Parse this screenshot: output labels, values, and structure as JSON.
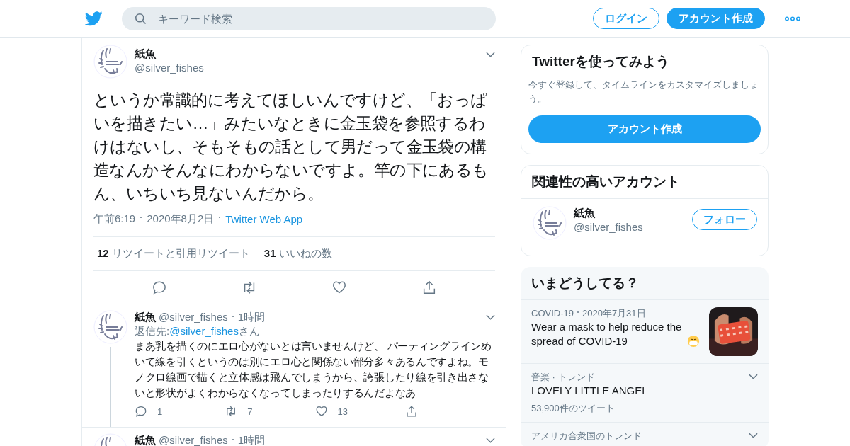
{
  "header": {
    "search": {
      "placeholder": "キーワード検索"
    },
    "buttons": [
      {
        "label": "ログイン",
        "kind": "outline"
      },
      {
        "label": "アカウント作成",
        "kind": "filled"
      }
    ]
  },
  "main_tweet": {
    "name": "紙魚",
    "handle": "@silver_fishes",
    "text": "というか常識的に考えてほしいんですけど、「おっぱいを描きたい…」みたいなときに金玉袋を参照するわけはないし、そもそもの話として男だって金玉袋の構造なんかそんなにわからないですよ。竿の下にあるもん、いちいち見ないんだから。",
    "time": "午前6:19",
    "date": "2020年8月2日",
    "source": "Twitter Web App",
    "stats": [
      {
        "count": "12",
        "label": "リツイートと引用リツイート"
      },
      {
        "count": "31",
        "label": "いいねの数"
      }
    ],
    "actions": [
      {
        "kind": "reply"
      },
      {
        "kind": "retweet"
      },
      {
        "kind": "like"
      },
      {
        "kind": "share"
      }
    ]
  },
  "replies": [
    {
      "name": "紙魚",
      "handle": "@silver_fishes",
      "time": "1時間",
      "reply_to_label": "返信先:",
      "reply_to": "@silver_fishes",
      "reply_to_suffix": "さん",
      "text": "まあ乳を描くのにエロ心がないとは言いませんけど、 パーティングラインめいて線を引くというのは別にエロ心と関係ない部分多々あるんですよね。モノクロ線画で描くと立体感は飛んでしまうから、誇張したり線を引き出さないと形状がよくわからなくなってしまったりするんだよなあ",
      "actions": [
        {
          "kind": "reply",
          "count": "1"
        },
        {
          "kind": "retweet",
          "count": "7"
        },
        {
          "kind": "like",
          "count": "13"
        },
        {
          "kind": "share"
        }
      ]
    },
    {
      "name": "紙魚",
      "handle": "@silver_fishes",
      "time": "1時間"
    }
  ],
  "sidebar": {
    "signup": {
      "title": "Twitterを使ってみよう",
      "text": "今すぐ登録して、タイムラインをカスタマイズしましょう。",
      "button": "アカウント作成"
    },
    "related": {
      "title": "関連性の高いアカウント",
      "accounts": [
        {
          "name": "紙魚",
          "handle": "@silver_fishes",
          "button": "フォロー"
        }
      ]
    },
    "trends": {
      "title": "いまどうしてる？",
      "items": [
        {
          "kind": "news",
          "context": "COVID-19",
          "date": "2020年7月31日",
          "title": "Wear a mask to help reduce the spread of COVID-19"
        },
        {
          "kind": "trend",
          "context": "音楽 · トレンド",
          "title": "LOVELY LITTLE ANGEL",
          "count": "53,900件のツイート"
        },
        {
          "kind": "trend",
          "context": "アメリカ合衆国のトレンド"
        }
      ]
    }
  }
}
